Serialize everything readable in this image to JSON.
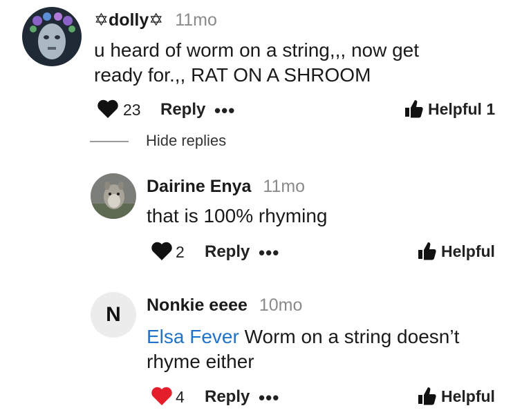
{
  "comments": [
    {
      "username": "✡dolly✡",
      "time": "11mo",
      "text": "u heard of worm on a string,,, now get ready for.,, RAT ON A SHROOM",
      "likes": "23",
      "liked": false,
      "reply_label": "Reply",
      "more_label": "•••",
      "helpful_label": "Helpful 1"
    },
    {
      "username": "Dairine Enya",
      "time": "11mo",
      "text": "that is 100% rhyming",
      "likes": "2",
      "liked": false,
      "reply_label": "Reply",
      "more_label": "•••",
      "helpful_label": "Helpful"
    },
    {
      "username": "Nonkie eeee",
      "time": "10mo",
      "avatar_initial": "N",
      "mention": "Elsa Fever",
      "text": "Worm on a string doesn’t rhyme either",
      "likes": "4",
      "liked": true,
      "reply_label": "Reply",
      "more_label": "•••",
      "helpful_label": "Helpful"
    }
  ],
  "hide_replies_label": "Hide replies",
  "colors": {
    "like_active": "#e41e2b",
    "like_inactive": "#111111",
    "mention": "#1f73c9",
    "timestamp": "#8a8a8a"
  },
  "icons": {
    "like": "heart-icon",
    "helpful": "thumbs-up-icon",
    "more": "more-icon"
  }
}
